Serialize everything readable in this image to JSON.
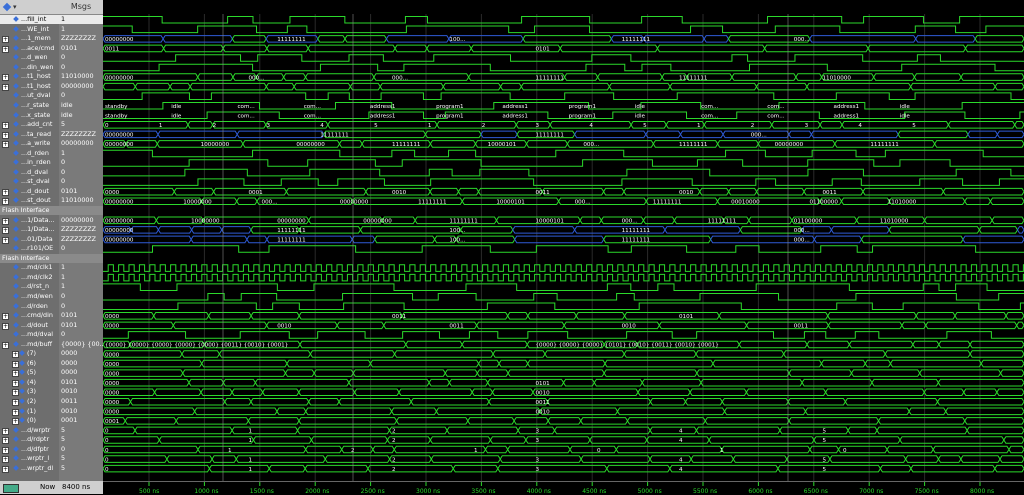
{
  "panel": {
    "msgs_header": "Msgs"
  },
  "signals": [
    {
      "name": "...fill_int",
      "value": "1",
      "sel": true
    },
    {
      "name": "...WE_int",
      "value": "1"
    },
    {
      "name": "...1_mem",
      "value": "ZZZZZZZZ",
      "exp": true
    },
    {
      "name": "...ace/cmd",
      "value": "0101",
      "exp": true
    },
    {
      "name": "...d_wen",
      "value": "0"
    },
    {
      "name": "...din_wen",
      "value": "0"
    },
    {
      "name": "...t1_host",
      "value": "11010000",
      "exp": true
    },
    {
      "name": "...t1_host",
      "value": "00000000",
      "exp": true
    },
    {
      "name": "...ut_dval",
      "value": "0"
    },
    {
      "name": "...r_state",
      "value": "idle"
    },
    {
      "name": "...x_state",
      "value": "idle"
    },
    {
      "name": "...add_cnt",
      "value": "5",
      "exp": true
    },
    {
      "name": "...ta_read",
      "value": "ZZZZZZZZ",
      "exp": true
    },
    {
      "name": "...a_write",
      "value": "00000000",
      "exp": true
    },
    {
      "name": "...d_rden",
      "value": "1"
    },
    {
      "name": "...in_rden",
      "value": "0"
    },
    {
      "name": "...d_dval",
      "value": "0"
    },
    {
      "name": "...st_dval",
      "value": "0"
    },
    {
      "name": "...d_dout",
      "value": "0101",
      "exp": true
    },
    {
      "name": "...st_dout",
      "value": "11010000",
      "exp": true
    },
    {
      "name": "Flash Interface",
      "value": "",
      "group": true
    },
    {
      "name": "...1/Data...",
      "value": "00000000",
      "exp": true
    },
    {
      "name": "...1/Data...",
      "value": "ZZZZZZZZ",
      "exp": true
    },
    {
      "name": "...01/Data",
      "value": "ZZZZZZZZ",
      "exp": true
    },
    {
      "name": "...r101/OE",
      "value": "0"
    },
    {
      "name": "Flash Interface",
      "value": "",
      "group": true
    },
    {
      "name": "...md/clk1",
      "value": "1"
    },
    {
      "name": "...md/clk2",
      "value": "1"
    },
    {
      "name": "...d/rst_n",
      "value": "1"
    },
    {
      "name": "...md/wen",
      "value": "0"
    },
    {
      "name": "...d/rden",
      "value": "0"
    },
    {
      "name": "...cmd/din",
      "value": "0101",
      "exp": true
    },
    {
      "name": "...d/dout",
      "value": "0101",
      "exp": true
    },
    {
      "name": "...md/dval",
      "value": "0"
    },
    {
      "name": "...md/buff",
      "value": "{0000} {00...",
      "exp": true
    },
    {
      "name": "(7)",
      "value": "0000",
      "exp": true,
      "indent": true
    },
    {
      "name": "(6)",
      "value": "0000",
      "exp": true,
      "indent": true
    },
    {
      "name": "(5)",
      "value": "0000",
      "exp": true,
      "indent": true
    },
    {
      "name": "(4)",
      "value": "0101",
      "exp": true,
      "indent": true
    },
    {
      "name": "(3)",
      "value": "0010",
      "exp": true,
      "indent": true
    },
    {
      "name": "(2)",
      "value": "0011",
      "exp": true,
      "indent": true
    },
    {
      "name": "(1)",
      "value": "0010",
      "exp": true,
      "indent": true
    },
    {
      "name": "(0)",
      "value": "0001",
      "exp": true,
      "indent": true
    },
    {
      "name": "...d/wrptr",
      "value": "5",
      "exp": true
    },
    {
      "name": "...d/rdptr",
      "value": "5",
      "exp": true
    },
    {
      "name": "...d/dfptr",
      "value": "0",
      "exp": true
    },
    {
      "name": "...wrptr_l",
      "value": "5",
      "exp": true
    },
    {
      "name": "...wrptr_dl",
      "value": "5",
      "exp": true
    }
  ],
  "bus_labels": [
    {
      "row": 2,
      "texts": [
        "00000000",
        "11111111",
        "100...",
        "11111111",
        "000..."
      ]
    },
    {
      "row": 3,
      "texts": [
        "0011",
        "0101"
      ]
    },
    {
      "row": 6,
      "texts": [
        "00000000",
        "000...",
        "000...",
        "11111111",
        "11111111",
        "11010000"
      ]
    },
    {
      "row": 9,
      "texts": [
        "standby",
        "idle",
        "com...",
        "com...",
        "address1",
        "program1",
        "address1",
        "program1",
        "idle",
        "com...",
        "com...",
        "address1",
        "idle"
      ]
    },
    {
      "row": 10,
      "texts": [
        "standby",
        "idle",
        "com...",
        "com...",
        "address1",
        "program1",
        "address1",
        "program1",
        "idle",
        "com...",
        "com...",
        "address1",
        "idle"
      ]
    },
    {
      "row": 11,
      "texts": [
        "0",
        "1",
        "2",
        "3",
        "4",
        "5",
        "1",
        "2",
        "3",
        "4",
        "5",
        "1",
        "2",
        "3",
        "4",
        "5"
      ]
    },
    {
      "row": 12,
      "texts": [
        "00000000",
        "11111111",
        "11111111",
        "000..."
      ]
    },
    {
      "row": 13,
      "texts": [
        "00000000",
        "10000000",
        "00000000",
        "11111111",
        "10000101",
        "000...",
        "11111111",
        "00000000",
        "11111111"
      ]
    },
    {
      "row": 18,
      "texts": [
        "0000",
        "0001",
        "0010",
        "0011",
        "0010",
        "0011"
      ]
    },
    {
      "row": 19,
      "texts": [
        "00000000",
        "10000000",
        "000...",
        "00000000",
        "11111111",
        "10000101",
        "000...",
        "11111111",
        "00010000",
        "01100000",
        "11010000"
      ]
    },
    {
      "row": 21,
      "texts": [
        "00000000",
        "10000000",
        "00000000",
        "00000000",
        "11111111",
        "10000101",
        "000...",
        "11111111",
        "01100000",
        "11010000"
      ]
    },
    {
      "row": 22,
      "texts": [
        "00000000",
        "11111111",
        "100...",
        "11111111",
        "000..."
      ]
    },
    {
      "row": 23,
      "texts": [
        "00000000",
        "11111111",
        "100...",
        "11111111",
        "000..."
      ]
    },
    {
      "row": 31,
      "texts": [
        "0000",
        "0011",
        "0101"
      ]
    },
    {
      "row": 32,
      "texts": [
        "0000",
        "0010",
        "0011",
        "0010",
        "0011"
      ]
    },
    {
      "row": 34,
      "texts": [
        "{0000} {0000} {0000} {0000} {0000} {0011} {0010} {0001}",
        "{0000} {0000} {0000} {0101} {0010} {0011} {0010} {0001}"
      ]
    },
    {
      "row": 35,
      "texts": [
        "0000"
      ]
    },
    {
      "row": 36,
      "texts": [
        "0000"
      ]
    },
    {
      "row": 37,
      "texts": [
        "0000"
      ]
    },
    {
      "row": 38,
      "texts": [
        "0000",
        "0101"
      ]
    },
    {
      "row": 39,
      "texts": [
        "0000",
        "0010"
      ]
    },
    {
      "row": 40,
      "texts": [
        "0000",
        "0011"
      ]
    },
    {
      "row": 41,
      "texts": [
        "0000",
        "0010"
      ]
    },
    {
      "row": 42,
      "texts": [
        "0001"
      ]
    },
    {
      "row": 43,
      "texts": [
        "0",
        "1",
        "2",
        "3",
        "4",
        "5"
      ]
    },
    {
      "row": 44,
      "texts": [
        "0",
        "1",
        "2",
        "3",
        "4",
        "5"
      ]
    },
    {
      "row": 45,
      "texts": [
        "0",
        "1",
        "2",
        "1",
        "0",
        "1",
        "0"
      ]
    },
    {
      "row": 46,
      "texts": [
        "0",
        "1",
        "2",
        "3",
        "4",
        "5"
      ]
    },
    {
      "row": 47,
      "texts": [
        "0",
        "1",
        "2",
        "3",
        "4",
        "5"
      ]
    }
  ],
  "timeline": {
    "now_label": "Now",
    "now_value": "8400 ns",
    "ticks": [
      "500 ns",
      "1000 ns",
      "1500 ns",
      "2000 ns",
      "2500 ns",
      "3000 ns",
      "3500 ns",
      "4000 ns",
      "4500 ns",
      "5000 ns",
      "5500 ns",
      "6000 ns",
      "6500 ns",
      "7000 ns",
      "7500 ns",
      "8000 ns"
    ]
  },
  "colors": {
    "wave": "#2bd92b",
    "bus_z": "#2f5bd6",
    "cursor": "#d9c21f",
    "grid": "#2a2a2a"
  }
}
